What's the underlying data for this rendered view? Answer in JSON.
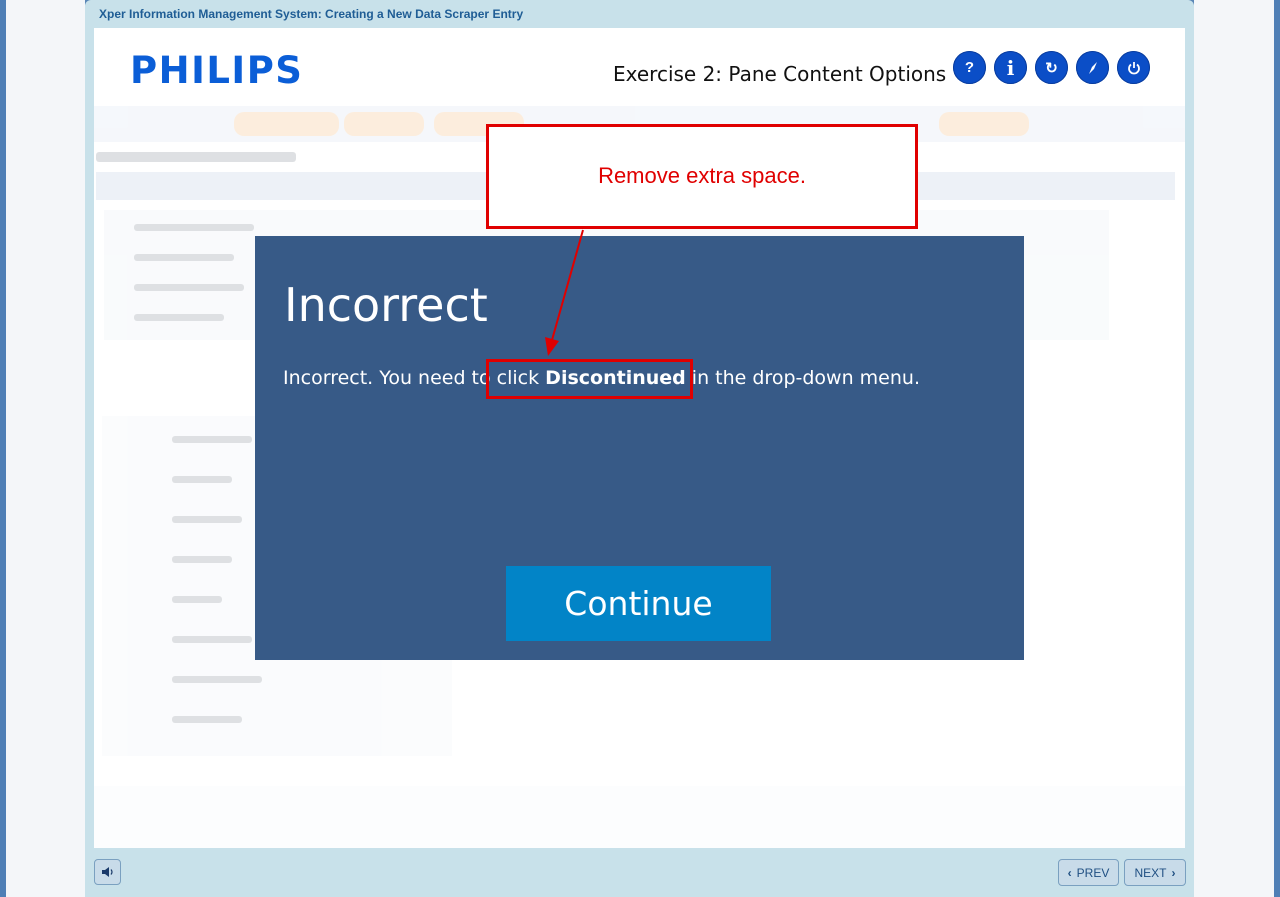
{
  "window": {
    "title": "Xper Information Management System: Creating a New Data Scraper Entry"
  },
  "header": {
    "logo": "PHILIPS",
    "exercise_title": "Exercise 2: Pane Content Options",
    "icons": [
      {
        "name": "help",
        "glyph": "?"
      },
      {
        "name": "info",
        "glyph": "i"
      },
      {
        "name": "replay",
        "glyph": "↻"
      },
      {
        "name": "compass",
        "glyph": "⚲"
      },
      {
        "name": "power",
        "glyph": "⏻"
      }
    ]
  },
  "modal": {
    "title": "Incorrect",
    "message_before": "Incorrect. You need to click ",
    "message_bold": "Discontinued",
    "message_after": " in the drop-down menu.",
    "continue_label": "Continue",
    "background_color": "#375a87",
    "button_color": "#0284c7"
  },
  "annotation": {
    "callout_text": "Remove extra space.",
    "color": "#e00000"
  },
  "footer": {
    "prev_label": "PREV",
    "next_label": "NEXT"
  },
  "colors": {
    "frame": "#c8e1ea",
    "brand_blue": "#0b5ed7",
    "icon_blue": "#0b4ec7"
  }
}
